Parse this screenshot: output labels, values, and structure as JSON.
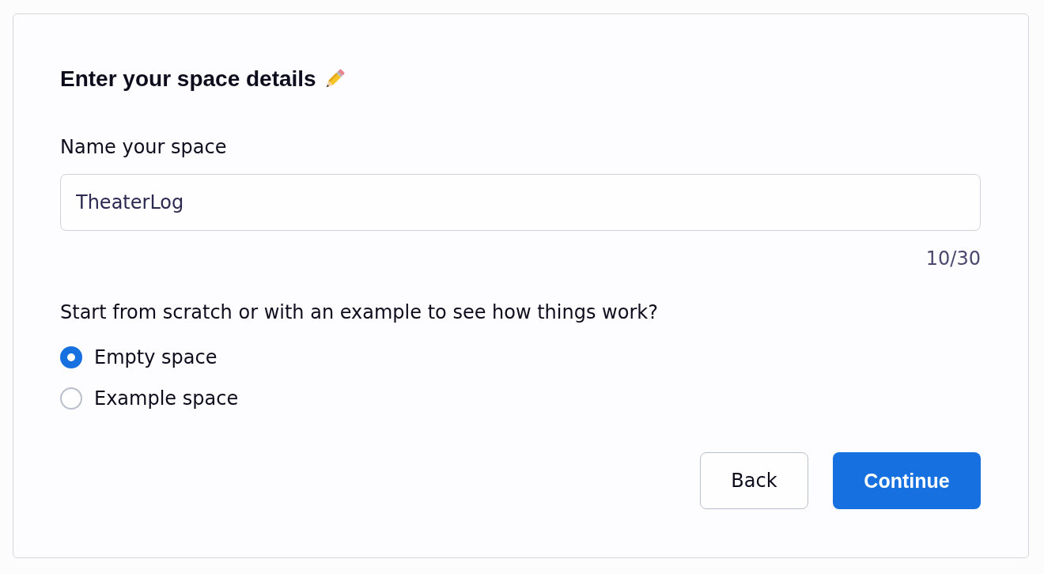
{
  "card": {
    "title": "Enter your space details",
    "name_field": {
      "label": "Name your space",
      "value": "TheaterLog",
      "counter": "10/30"
    },
    "start_question": "Start from scratch or with an example to see how things work?",
    "options": [
      {
        "label": "Empty space",
        "selected": true
      },
      {
        "label": "Example space",
        "selected": false
      }
    ],
    "buttons": [
      {
        "label": "Back",
        "kind": "secondary"
      },
      {
        "label": "Continue",
        "kind": "primary"
      }
    ]
  }
}
